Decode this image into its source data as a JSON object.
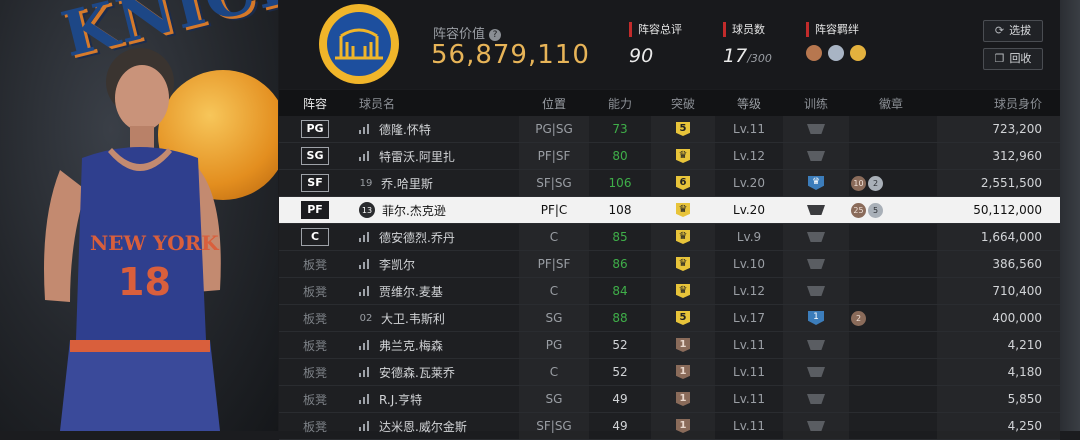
{
  "header": {
    "value_label": "阵容价值",
    "value": "56,879,110",
    "rating_label": "阵容总评",
    "rating": "90",
    "roster_label": "球员数",
    "roster_count": "17",
    "roster_max": "/300",
    "bonds_label": "阵容羁绊",
    "select_label": "选拔",
    "recycle_label": "回收"
  },
  "columns": {
    "lineup": "阵容",
    "name": "球员名",
    "position": "位置",
    "ability": "能力",
    "breakthrough": "突破",
    "level": "等级",
    "training": "训练",
    "badge": "徽章",
    "value": "球员身价"
  },
  "players": [
    {
      "slot": "PG",
      "jersey": "",
      "name": "德隆.怀特",
      "pos": "PG|SG",
      "ovr": "73",
      "brk": "5",
      "lv": "Lv.11",
      "train": "",
      "badges": [],
      "value": "723,200"
    },
    {
      "slot": "SG",
      "jersey": "",
      "name": "特雷沃.阿里扎",
      "pos": "PF|SF",
      "ovr": "80",
      "brk": "♛",
      "lv": "Lv.12",
      "train": "",
      "badges": [],
      "value": "312,960"
    },
    {
      "slot": "SF",
      "jersey": "19",
      "name": "乔.哈里斯",
      "pos": "SF|SG",
      "ovr": "106",
      "brk": "6",
      "lv": "Lv.20",
      "train": "♛",
      "badges": [
        "10",
        "2"
      ],
      "value": "2,551,500"
    },
    {
      "slot": "PF",
      "jersey": "13",
      "name": "菲尔.杰克逊",
      "pos": "PF|C",
      "ovr": "108",
      "brk": "♛",
      "lv": "Lv.20",
      "train": "",
      "badges": [
        "25",
        "5"
      ],
      "value": "50,112,000"
    },
    {
      "slot": "C",
      "jersey": "",
      "name": "德安德烈.乔丹",
      "pos": "C",
      "ovr": "85",
      "brk": "♛",
      "lv": "Lv.9",
      "train": "",
      "badges": [],
      "value": "1,664,000"
    },
    {
      "slot": "板凳",
      "jersey": "",
      "name": "李凯尔",
      "pos": "PF|SF",
      "ovr": "86",
      "brk": "♛",
      "lv": "Lv.10",
      "train": "",
      "badges": [],
      "value": "386,560"
    },
    {
      "slot": "板凳",
      "jersey": "",
      "name": "贾维尔.麦基",
      "pos": "C",
      "ovr": "84",
      "brk": "♛",
      "lv": "Lv.12",
      "train": "",
      "badges": [],
      "value": "710,400"
    },
    {
      "slot": "板凳",
      "jersey": "02",
      "name": "大卫.韦斯利",
      "pos": "SG",
      "ovr": "88",
      "brk": "5",
      "lv": "Lv.17",
      "train": "1",
      "badges": [
        "2"
      ],
      "value": "400,000"
    },
    {
      "slot": "板凳",
      "jersey": "",
      "name": "弗兰克.梅森",
      "pos": "PG",
      "ovr": "52",
      "brk": "1",
      "lv": "Lv.11",
      "train": "",
      "badges": [],
      "value": "4,210"
    },
    {
      "slot": "板凳",
      "jersey": "",
      "name": "安德森.瓦莱乔",
      "pos": "C",
      "ovr": "52",
      "brk": "1",
      "lv": "Lv.11",
      "train": "",
      "badges": [],
      "value": "4,180"
    },
    {
      "slot": "板凳",
      "jersey": "",
      "name": "R.J.亨特",
      "pos": "SG",
      "ovr": "49",
      "brk": "1",
      "lv": "Lv.11",
      "train": "",
      "badges": [],
      "value": "5,850"
    },
    {
      "slot": "板凳",
      "jersey": "",
      "name": "达米恩.威尔金斯",
      "pos": "SF|SG",
      "ovr": "49",
      "brk": "1",
      "lv": "Lv.11",
      "train": "",
      "badges": [],
      "value": "4,250"
    }
  ],
  "selected_row": 3,
  "colors": {
    "accent_gold": "#e7b458",
    "green": "#3fae49",
    "red_marker": "#c22b2b"
  }
}
